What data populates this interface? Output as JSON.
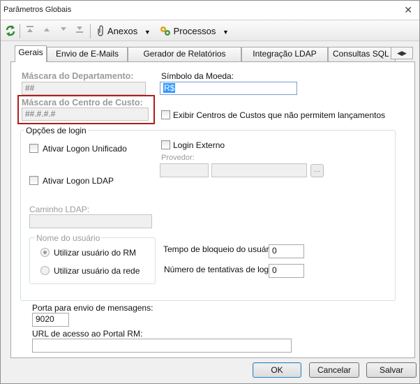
{
  "window": {
    "title": "Parâmetros Globais",
    "close_glyph": "✕"
  },
  "toolbar": {
    "anexos_label": "Anexos",
    "processos_label": "Processos"
  },
  "tabs": [
    {
      "label": "Gerais",
      "active": true
    },
    {
      "label": "Envio de E-Mails"
    },
    {
      "label": "Gerador de Relatórios"
    },
    {
      "label": "Integração LDAP"
    },
    {
      "label": "Consultas SQL"
    }
  ],
  "form": {
    "mascara_departamento_label": "Máscara do Departamento:",
    "mascara_departamento_value": "##",
    "simbolo_moeda_label": "Símbolo da Moeda:",
    "simbolo_moeda_value": "R$",
    "mascara_centro_custo_label": "Máscara do Centro de Custo:",
    "mascara_centro_custo_value": "##.#.#.#",
    "exibir_centros_label": "Exibir Centros de Custos que não permitem lançamentos"
  },
  "login_options": {
    "group_title": "Opções de login",
    "logon_unificado_label": "Ativar Logon Unificado",
    "login_externo_label": "Login Externo",
    "provedor_label": "Provedor:",
    "ellipsis": "...",
    "logon_ldap_label": "Ativar Logon LDAP",
    "caminho_ldap_label": "Caminho LDAP:",
    "nome_usuario_title": "Nome do usuário",
    "radio_rm_label": "Utilizar usuário do RM",
    "radio_rede_label": "Utilizar usuário da rede",
    "tempo_bloqueio_label": "Tempo de bloqueio do usuário:",
    "tempo_bloqueio_value": "0",
    "tentativas_label": "Número de tentativas de login:",
    "tentativas_value": "0"
  },
  "messaging": {
    "porta_label": "Porta para envio de mensagens:",
    "porta_value": "9020",
    "url_label": "URL de acesso ao Portal RM:",
    "url_value": ""
  },
  "buttons": {
    "ok": "OK",
    "cancelar": "Cancelar",
    "salvar": "Salvar"
  },
  "colors": {
    "selection": "#3399ff",
    "highlight_border": "#b01c1c"
  }
}
